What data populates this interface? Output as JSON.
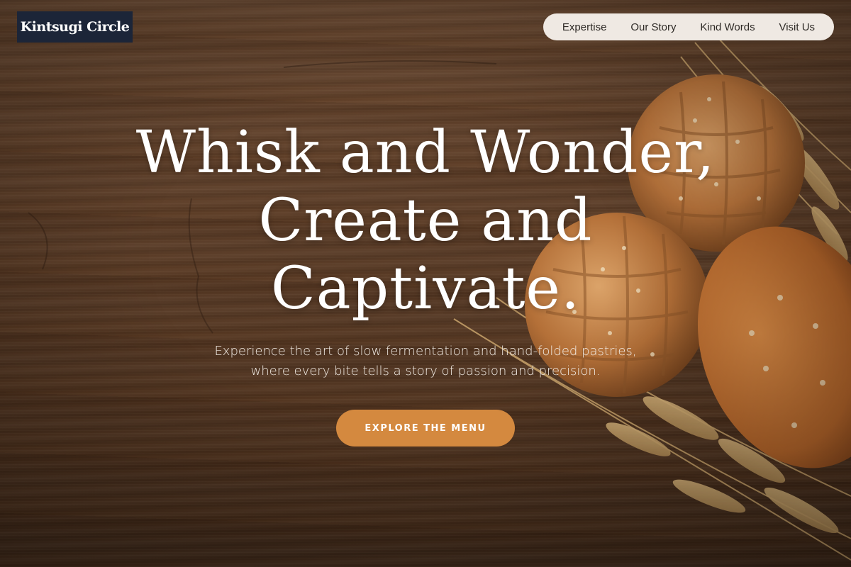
{
  "brand": {
    "name": "Kintsugi Circle",
    "logo_bg": "#1c2538"
  },
  "nav": {
    "items": [
      {
        "label": "Expertise"
      },
      {
        "label": "Our Story"
      },
      {
        "label": "Kind Words"
      },
      {
        "label": "Visit Us"
      }
    ],
    "background": "#efe9e3"
  },
  "hero": {
    "headline_lines": [
      "Whisk and Wonder,",
      "Create and",
      "Captivate."
    ],
    "subtext_lines": [
      "Experience the art of slow fermentation and hand-folded pastries,",
      "where every bite tells a story of passion and precision."
    ],
    "cta_label": "EXPLORE THE MENU",
    "accent_color": "#d4893f"
  },
  "background_image": {
    "subject": "bread-loaves-and-wheat-on-wooden-table"
  }
}
